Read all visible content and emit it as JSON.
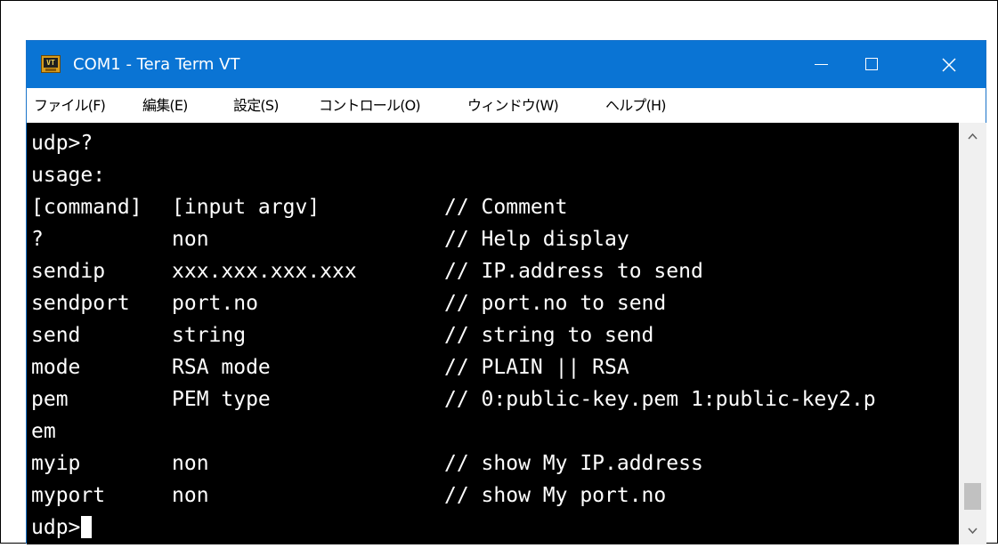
{
  "window": {
    "title": "COM1 - Tera Term VT",
    "icon_label": "VT",
    "colors": {
      "titlebar": "#0a74d4",
      "terminal_bg": "#000000",
      "terminal_fg": "#ffffff"
    }
  },
  "menu": {
    "file": "ファイル(F)",
    "edit": "編集(E)",
    "setup": "設定(S)",
    "control": "コントロール(O)",
    "window": "ウィンドウ(W)",
    "help": "ヘルプ(H)"
  },
  "terminal": {
    "line1": "udp>?",
    "line2": "usage:",
    "header": {
      "command": "[command]",
      "argv": "[input argv]",
      "comment": "// Comment"
    },
    "rows": [
      {
        "cmd": "?",
        "arg": "non",
        "comment": "// Help display"
      },
      {
        "cmd": "sendip",
        "arg": "xxx.xxx.xxx.xxx",
        "comment": "// IP.address to send"
      },
      {
        "cmd": "sendport",
        "arg": "port.no",
        "comment": "// port.no to send"
      },
      {
        "cmd": "send",
        "arg": "string",
        "comment": "// string to send"
      },
      {
        "cmd": "mode",
        "arg": "RSA mode",
        "comment": "// PLAIN || RSA"
      },
      {
        "cmd": "pem",
        "arg": "PEM type",
        "comment": "// 0:public-key.pem 1:public-key2.p"
      },
      {
        "cmd": "em",
        "arg": "",
        "comment": ""
      },
      {
        "cmd": "myip",
        "arg": "non",
        "comment": "// show My IP.address"
      },
      {
        "cmd": "myport",
        "arg": "non",
        "comment": "// show My port.no"
      }
    ],
    "prompt": "udp>"
  },
  "icons": {
    "minimize": "minimize-icon",
    "maximize": "maximize-icon",
    "close": "close-icon",
    "scroll_up": "chevron-up-icon",
    "scroll_down": "chevron-down-icon"
  }
}
